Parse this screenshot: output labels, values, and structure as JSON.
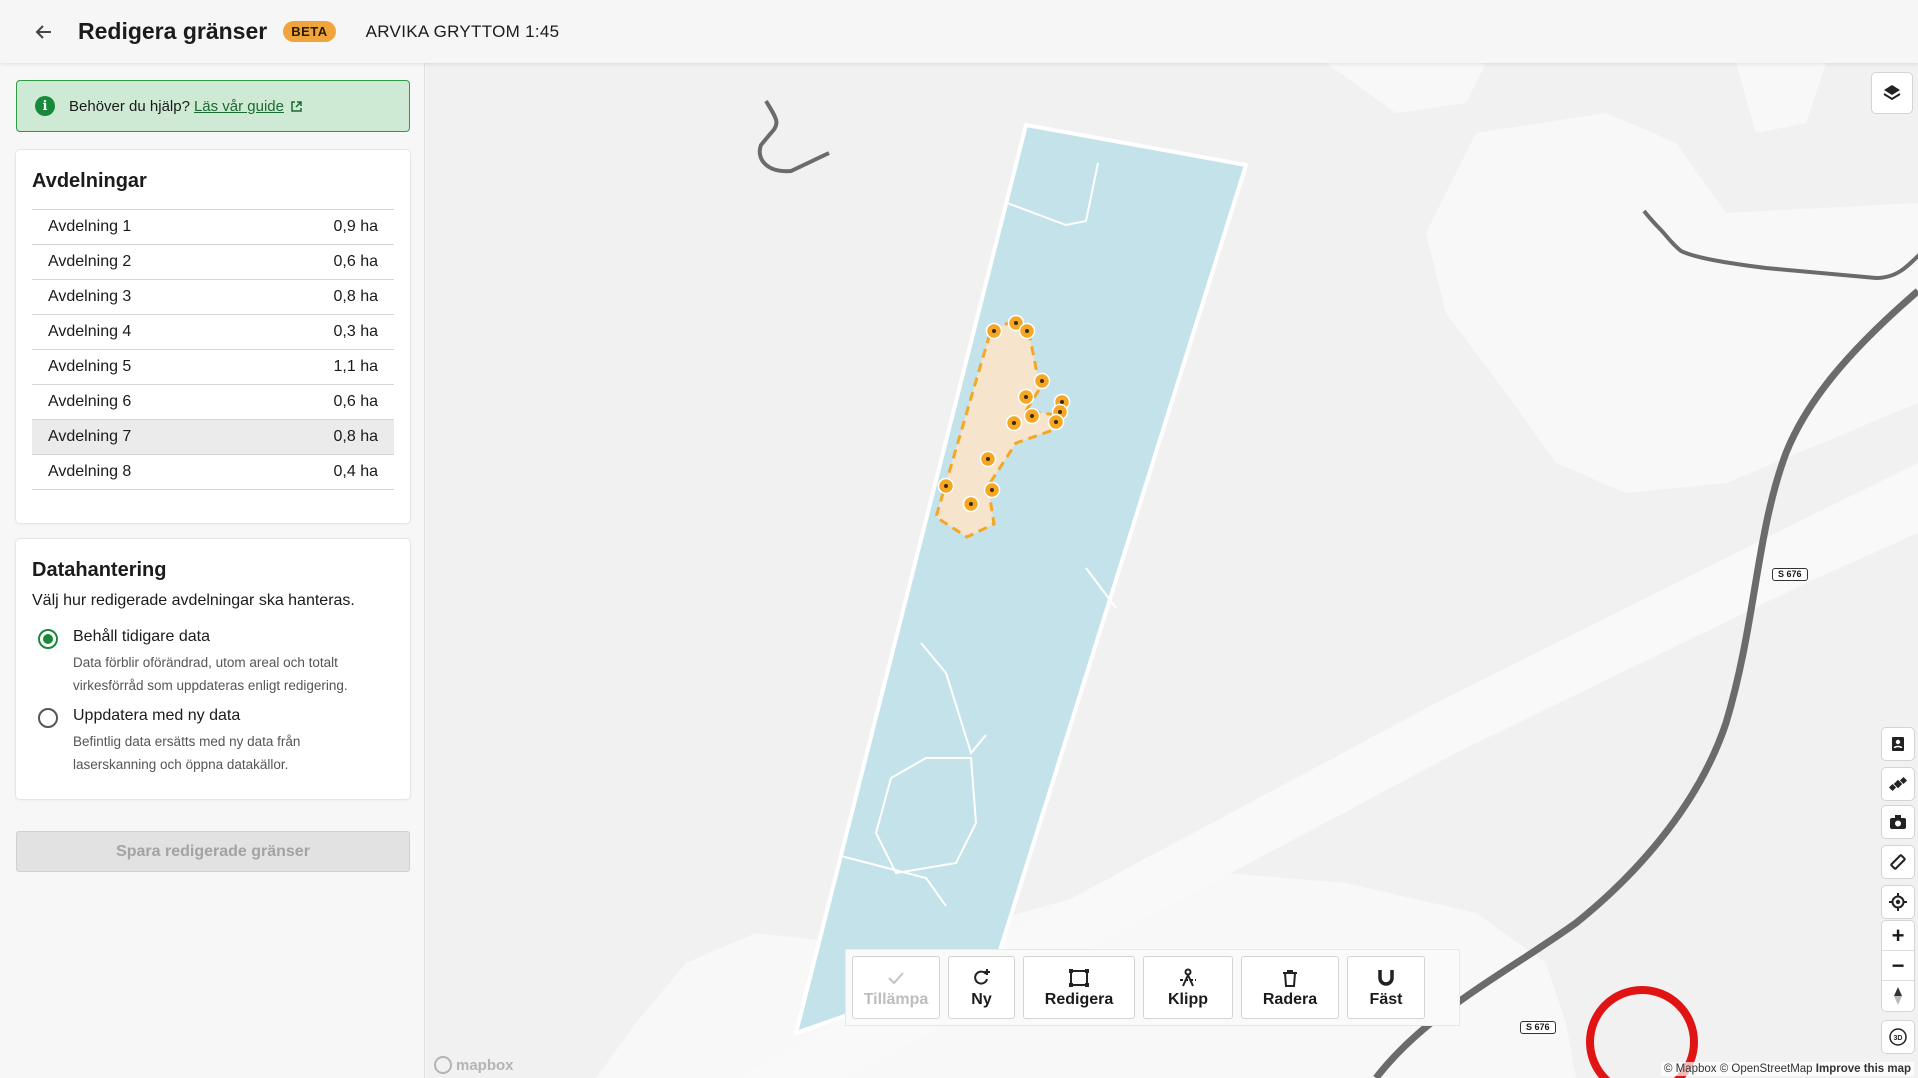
{
  "header": {
    "title": "Redigera gränser",
    "badge": "BETA",
    "property": "ARVIKA GRYTTOM 1:45"
  },
  "help": {
    "text": "Behöver du hjälp?",
    "link": "Läs vår guide"
  },
  "avdelningar": {
    "title": "Avdelningar",
    "rows": [
      {
        "name": "Avdelning 1",
        "area": "0,9 ha"
      },
      {
        "name": "Avdelning 2",
        "area": "0,6 ha"
      },
      {
        "name": "Avdelning 3",
        "area": "0,8 ha"
      },
      {
        "name": "Avdelning 4",
        "area": "0,3 ha"
      },
      {
        "name": "Avdelning 5",
        "area": "1,1 ha"
      },
      {
        "name": "Avdelning 6",
        "area": "0,6 ha"
      },
      {
        "name": "Avdelning 7",
        "area": "0,8 ha"
      },
      {
        "name": "Avdelning 8",
        "area": "0,4 ha"
      }
    ],
    "selected": "Avdelning 7"
  },
  "datahantering": {
    "title": "Datahantering",
    "description": "Välj hur redigerade avdelningar ska hanteras.",
    "options": [
      {
        "title": "Behåll tidigare data",
        "sub1": "Data förblir oförändrad, utom areal och totalt",
        "sub2": "virkesförråd som uppdateras enligt redigering.",
        "selected": true
      },
      {
        "title": "Uppdatera med ny data",
        "sub1": "Befintlig data ersätts med ny data från",
        "sub2": "laserskanning och öppna datakällor.",
        "selected": false
      }
    ]
  },
  "save_button": "Spara redigerade gränser",
  "toolbar": {
    "apply": "Tillämpa",
    "new": "Ny",
    "edit": "Redigera",
    "cut": "Klipp",
    "delete": "Radera",
    "snap": "Fäst"
  },
  "map": {
    "road_shield": "S 676",
    "mapbox": "mapbox",
    "attribution": "© Mapbox © OpenStreetMap",
    "improve": "Improve this map",
    "colors": {
      "stand_fill": "#c4e2ea",
      "edit_fill": "#f6e5cc",
      "edit_vertex": "#f5a623",
      "highlight": "#e01414"
    }
  },
  "icons": [
    "back-arrow-icon",
    "info-icon",
    "external-link-icon",
    "layers-icon",
    "contacts-icon",
    "satellite-icon",
    "camera-icon",
    "ruler-icon",
    "locate-icon",
    "zoom-in-icon",
    "zoom-out-icon",
    "compass-icon",
    "3d-icon",
    "check-icon",
    "new-polygon-icon",
    "edit-polygon-icon",
    "cut-icon",
    "trash-icon",
    "magnet-icon"
  ]
}
